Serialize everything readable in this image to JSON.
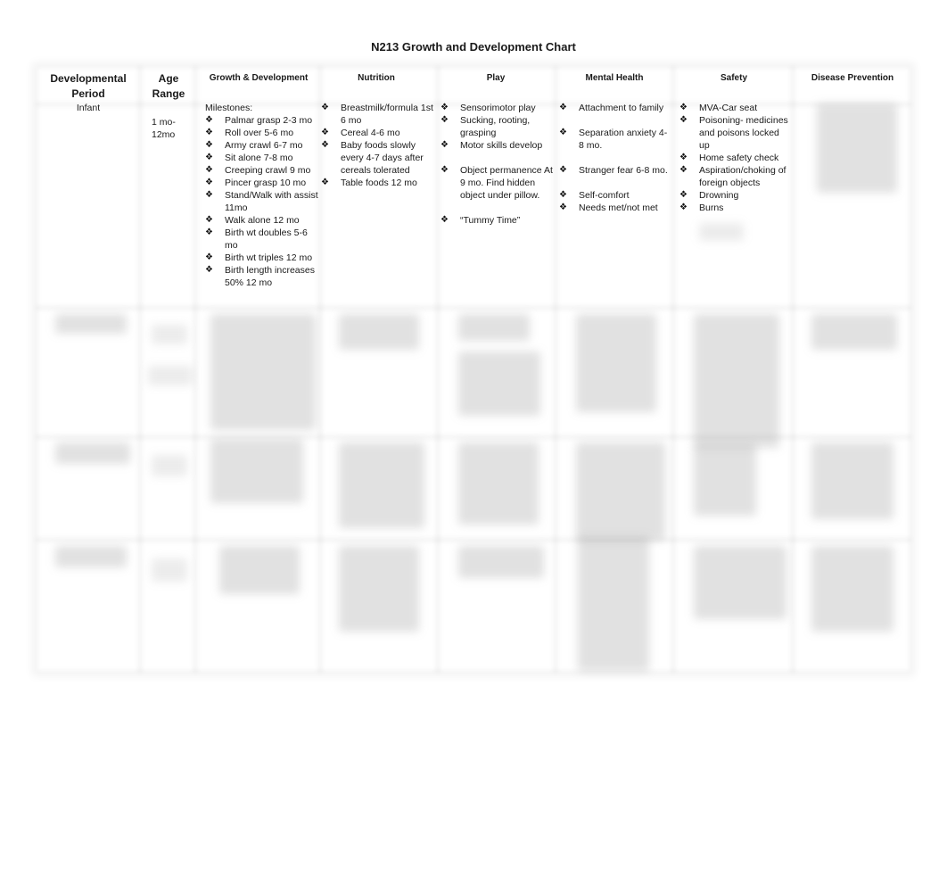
{
  "document": {
    "title": "N213 Growth and Development Chart"
  },
  "table": {
    "headers": [
      "Developmental Period",
      "Age Range",
      "Growth & Development",
      "Nutrition",
      "Play",
      "Mental Health",
      "Safety",
      "Disease Prevention"
    ],
    "header_lines": {
      "developmental_period_1": "Developmental",
      "developmental_period_2": "Period",
      "age_range_1": "Age",
      "age_range_2": "Range"
    },
    "bullet_icon": "❖",
    "rows": [
      {
        "period": "Infant",
        "age_range_1": "1 mo-",
        "age_range_2": "12mo",
        "growth_intro": "Milestones:",
        "growth": [
          "Palmar grasp 2-3 mo",
          "Roll over 5-6 mo",
          "Army crawl 6-7 mo",
          "Sit alone 7-8 mo",
          "Creeping crawl 9 mo",
          "Pincer grasp 10 mo",
          "Stand/Walk with assist 11mo",
          "Walk alone 12 mo",
          "Birth wt doubles 5-6 mo",
          "Birth wt triples 12 mo",
          "Birth length increases 50% 12 mo"
        ],
        "nutrition": [
          "Breastmilk/formula 1st 6 mo",
          "Cereal 4-6 mo",
          "Baby foods slowly every 4-7 days after cereals tolerated",
          "Table foods 12 mo"
        ],
        "play": [
          "Sensorimotor play",
          "Sucking, rooting, grasping",
          "Motor skills develop",
          "Object permanence At 9 mo. Find hidden object under pillow.",
          "“Tummy Time”"
        ],
        "mental_health": [
          "Attachment to family",
          "Separation anxiety 4-8 mo.",
          "Stranger fear 6-8 mo.",
          "Self-comfort",
          "Needs met/not met"
        ],
        "safety": [
          "MVA-Car seat",
          "Poisoning- medicines and poisons locked up",
          "Home safety check",
          "Aspiration/choking of foreign objects",
          "Drowning",
          "Burns"
        ],
        "disease_prevention": "[blurred]"
      },
      {
        "state": "blurred"
      },
      {
        "state": "blurred"
      },
      {
        "state": "blurred"
      }
    ]
  }
}
